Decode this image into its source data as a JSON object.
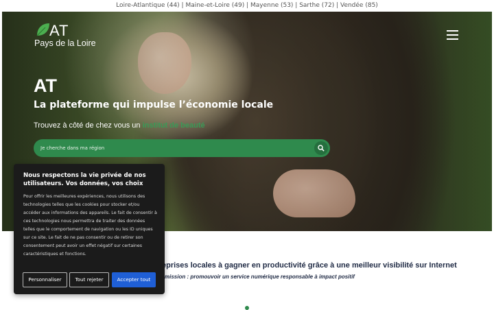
{
  "topbar": {
    "text": "Loire-Atlantique (44) | Maine-et-Loire (49) | Mayenne (53) | Sarthe (72) | Vendée (85)"
  },
  "logo": {
    "main": "AT",
    "sub": "Pays de la Loire"
  },
  "hero": {
    "title": "AT",
    "subtitle": "La plateforme qui impulse l’économie locale",
    "find_prefix": "Trouvez à côté de chez vous un ",
    "find_highlight": "institut de beauté"
  },
  "search": {
    "placeholder": "Je cherche dans ma région"
  },
  "section": {
    "title": "eprises locales à gagner en productivité grâce à une meilleur visibilité sur Internet",
    "subtitle": "mission : promouvoir un service numérique responsable à impact positif"
  },
  "cookie": {
    "title": "Nous respectons la vie privée de nos utilisateurs. Vos données, vos choix",
    "body": "Pour offrir les meilleures expériences, nous utilisons des technologies telles que les cookies pour stocker et/ou accéder aux informations des appareils. Le fait de consentir à ces technologies nous permettra de traiter des données telles que le comportement de navigation ou les ID uniques sur ce site. Le fait de ne pas consentir ou de retirer son consentement peut avoir un effet négatif sur certaines caractéristiques et fonctions.",
    "customize": "Personnaliser",
    "reject": "Tout rejeter",
    "accept": "Accepter tout"
  },
  "colors": {
    "brand_green": "#2f8a4d",
    "accept_blue": "#1f5fd6",
    "cookie_bg": "#1b1b1b"
  },
  "icons": {
    "menu": "hamburger-menu-icon",
    "search": "search-icon",
    "logo_leaf": "leaf-icon"
  }
}
